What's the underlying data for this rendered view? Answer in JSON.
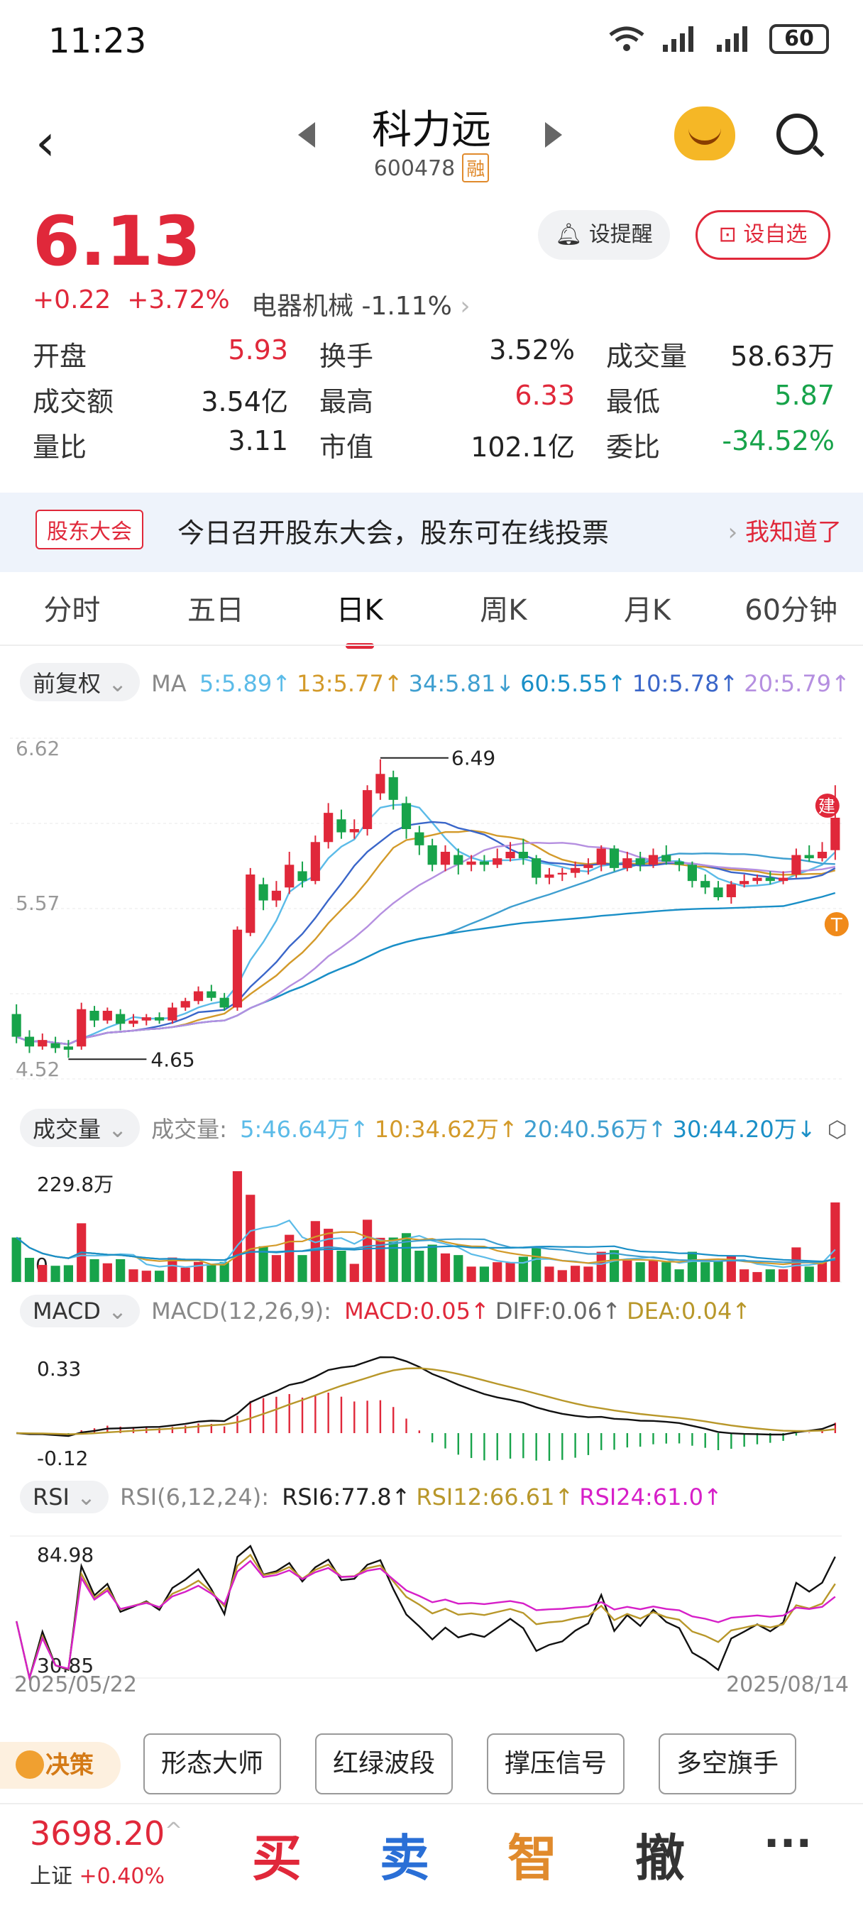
{
  "status": {
    "time": "11:23",
    "battery": "60"
  },
  "header": {
    "title": "科力远",
    "code": "600478",
    "margin_tag": "融"
  },
  "quote": {
    "price": "6.13",
    "change": "+0.22",
    "change_pct": "+3.72%",
    "sector": "电器机械 -1.11%",
    "alert_label": "设提醒",
    "fav_label": "设自选"
  },
  "stats": [
    [
      {
        "label": "开盘",
        "value": "5.93",
        "tone": "red"
      },
      {
        "label": "换手",
        "value": "3.52%",
        "tone": ""
      },
      {
        "label": "成交量",
        "value": "58.63万",
        "tone": ""
      }
    ],
    [
      {
        "label": "成交额",
        "value": "3.54亿",
        "tone": ""
      },
      {
        "label": "最高",
        "value": "6.33",
        "tone": "red"
      },
      {
        "label": "最低",
        "value": "5.87",
        "tone": "green"
      }
    ],
    [
      {
        "label": "量比",
        "value": "3.11",
        "tone": ""
      },
      {
        "label": "市值",
        "value": "102.1亿",
        "tone": ""
      },
      {
        "label": "委比",
        "value": "-34.52%",
        "tone": "green"
      }
    ]
  ],
  "notice": {
    "badge": "股东大会",
    "text": "今日召开股东大会，股东可在线投票",
    "link": "我知道了"
  },
  "tabs": [
    "分时",
    "五日",
    "日K",
    "周K",
    "月K",
    "60分钟"
  ],
  "tab_active": 2,
  "kline": {
    "fq_label": "前复权",
    "ma_title": "MA",
    "ma_items": [
      {
        "text": "5:5.89↑",
        "color": "#5bbbe8"
      },
      {
        "text": "13:5.77↑",
        "color": "#d39a2a"
      },
      {
        "text": "34:5.81↓",
        "color": "#3f9fd0"
      },
      {
        "text": "60:5.55↑",
        "color": "#1a8fc7"
      },
      {
        "text": "10:5.78↑",
        "color": "#3a66c9"
      },
      {
        "text": "20:5.79↑",
        "color": "#b58fe0"
      }
    ],
    "y_top": "6.62",
    "y_mid": "5.57",
    "y_bottom": "4.52",
    "high_mark": "6.49",
    "low_mark": "4.65",
    "tag_build": "建",
    "tag_t": "T",
    "colors": {
      "up": "#e0283a",
      "down": "#17a34a"
    }
  },
  "chart_data": {
    "type": "candlestick",
    "x_start": "2025/05/22",
    "x_end": "2025/08/14",
    "ylim": [
      4.52,
      6.62
    ],
    "candles": [
      [
        4.92,
        4.78,
        4.98,
        4.74
      ],
      [
        4.78,
        4.72,
        4.82,
        4.68
      ],
      [
        4.72,
        4.76,
        4.8,
        4.7
      ],
      [
        4.74,
        4.71,
        4.78,
        4.68
      ],
      [
        4.72,
        4.7,
        4.76,
        4.65
      ],
      [
        4.72,
        4.95,
        4.99,
        4.7
      ],
      [
        4.94,
        4.88,
        4.97,
        4.84
      ],
      [
        4.88,
        4.94,
        4.96,
        4.86
      ],
      [
        4.92,
        4.86,
        4.95,
        4.82
      ],
      [
        4.86,
        4.88,
        4.92,
        4.84
      ],
      [
        4.88,
        4.9,
        4.92,
        4.85
      ],
      [
        4.9,
        4.88,
        4.93,
        4.86
      ],
      [
        4.88,
        4.96,
        4.99,
        4.86
      ],
      [
        4.96,
        5.0,
        5.02,
        4.94
      ],
      [
        5.0,
        5.06,
        5.09,
        4.98
      ],
      [
        5.06,
        5.02,
        5.1,
        5.0
      ],
      [
        5.02,
        4.96,
        5.05,
        4.94
      ],
      [
        4.96,
        5.44,
        5.46,
        4.94
      ],
      [
        5.42,
        5.78,
        5.82,
        5.4
      ],
      [
        5.72,
        5.62,
        5.76,
        5.56
      ],
      [
        5.62,
        5.68,
        5.74,
        5.58
      ],
      [
        5.7,
        5.84,
        5.92,
        5.66
      ],
      [
        5.8,
        5.74,
        5.86,
        5.7
      ],
      [
        5.74,
        5.98,
        6.02,
        5.72
      ],
      [
        5.98,
        6.16,
        6.22,
        5.94
      ],
      [
        6.12,
        6.04,
        6.18,
        6.0
      ],
      [
        6.04,
        6.06,
        6.12,
        6.0
      ],
      [
        6.06,
        6.3,
        6.33,
        6.02
      ],
      [
        6.28,
        6.4,
        6.49,
        6.24
      ],
      [
        6.38,
        6.24,
        6.42,
        6.18
      ],
      [
        6.22,
        6.06,
        6.26,
        6.0
      ],
      [
        6.04,
        5.96,
        6.08,
        5.9
      ],
      [
        5.96,
        5.84,
        6.0,
        5.8
      ],
      [
        5.84,
        5.92,
        5.96,
        5.8
      ],
      [
        5.9,
        5.84,
        5.94,
        5.78
      ],
      [
        5.84,
        5.86,
        5.9,
        5.8
      ],
      [
        5.86,
        5.84,
        5.9,
        5.8
      ],
      [
        5.84,
        5.88,
        5.94,
        5.82
      ],
      [
        5.88,
        5.92,
        5.98,
        5.86
      ],
      [
        5.92,
        5.88,
        6.0,
        5.84
      ],
      [
        5.88,
        5.76,
        5.9,
        5.72
      ],
      [
        5.76,
        5.78,
        5.82,
        5.72
      ],
      [
        5.78,
        5.79,
        5.82,
        5.74
      ],
      [
        5.79,
        5.82,
        5.86,
        5.76
      ],
      [
        5.82,
        5.84,
        5.88,
        5.78
      ],
      [
        5.84,
        5.94,
        5.96,
        5.8
      ],
      [
        5.94,
        5.82,
        5.96,
        5.8
      ],
      [
        5.82,
        5.88,
        5.92,
        5.8
      ],
      [
        5.88,
        5.84,
        5.92,
        5.8
      ],
      [
        5.84,
        5.9,
        5.94,
        5.82
      ],
      [
        5.9,
        5.86,
        5.96,
        5.84
      ],
      [
        5.86,
        5.84,
        5.88,
        5.8
      ],
      [
        5.84,
        5.74,
        5.86,
        5.7
      ],
      [
        5.74,
        5.7,
        5.78,
        5.66
      ],
      [
        5.7,
        5.64,
        5.74,
        5.62
      ],
      [
        5.64,
        5.72,
        5.74,
        5.6
      ],
      [
        5.72,
        5.74,
        5.78,
        5.7
      ],
      [
        5.74,
        5.76,
        5.78,
        5.72
      ],
      [
        5.76,
        5.74,
        5.8,
        5.72
      ],
      [
        5.74,
        5.76,
        5.8,
        5.72
      ],
      [
        5.78,
        5.9,
        5.94,
        5.76
      ],
      [
        5.9,
        5.88,
        5.96,
        5.86
      ],
      [
        5.88,
        5.92,
        5.98,
        5.86
      ],
      [
        5.93,
        6.13,
        6.33,
        5.87
      ]
    ],
    "ma5_last": 5.89,
    "ma60_last": 5.55
  },
  "volume": {
    "label": "成交量",
    "title": "成交量:",
    "items": [
      {
        "text": "5:46.64万↑",
        "color": "#5bbbe8"
      },
      {
        "text": "10:34.62万↑",
        "color": "#d39a2a"
      },
      {
        "text": "20:40.56万↑",
        "color": "#3f9fd0"
      },
      {
        "text": "30:44.20万↓",
        "color": "#1a8fc7"
      }
    ],
    "y_top": "229.8万",
    "y_zero": "0"
  },
  "macd": {
    "label": "MACD",
    "title": "MACD(12,26,9):",
    "items": [
      {
        "text": "MACD:0.05↑",
        "color": "#e0283a"
      },
      {
        "text": "DIFF:0.06↑",
        "color": "#666666"
      },
      {
        "text": "DEA:0.04↑",
        "color": "#b8972a"
      }
    ],
    "y_top": "0.33",
    "y_bottom": "-0.12"
  },
  "rsi": {
    "label": "RSI",
    "title": "RSI(6,12,24):",
    "items": [
      {
        "text": "RSI6:77.8↑",
        "color": "#222222"
      },
      {
        "text": "RSI12:66.61↑",
        "color": "#b8972a"
      },
      {
        "text": "RSI24:61.0↑",
        "color": "#d61fc8"
      }
    ],
    "y_top": "84.98",
    "y_bottom": "30.85"
  },
  "tools": {
    "decide": "决策",
    "buttons": [
      "形态大师",
      "红绿波段",
      "撑压信号",
      "多空旗手"
    ]
  },
  "bottombar": {
    "index_value": "3698.20",
    "index_name": "上证",
    "index_pct": "+0.40%",
    "buy": "买",
    "sell": "卖",
    "smart": "智",
    "cancel": "撤",
    "more": "···"
  }
}
